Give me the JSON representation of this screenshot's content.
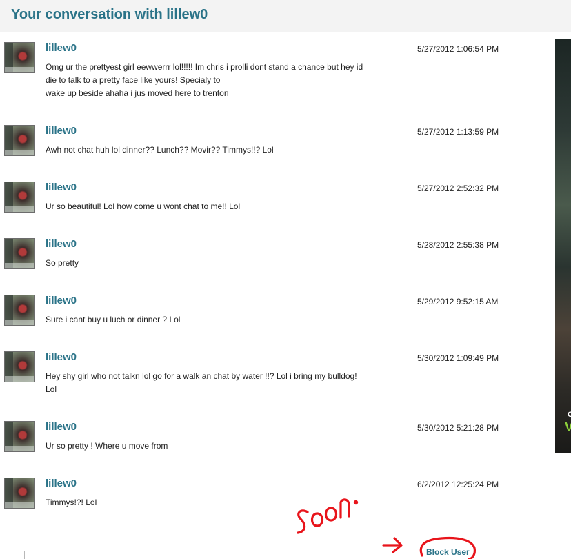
{
  "header": {
    "title": "Your conversation with lillew0"
  },
  "messages": [
    {
      "username": "lillew0",
      "timestamp": "5/27/2012 1:06:54 PM",
      "lines": [
        "Omg ur the prettyest girl eewwerrr lol!!!!! Im chris i prolli dont stand a chance but hey id",
        "die to talk to a pretty face like yours! Specialy to",
        "wake up beside ahaha i jus moved here to trenton"
      ]
    },
    {
      "username": "lillew0",
      "timestamp": "5/27/2012 1:13:59 PM",
      "lines": [
        "Awh not chat huh lol dinner?? Lunch?? Movir?? Timmys!!? Lol"
      ]
    },
    {
      "username": "lillew0",
      "timestamp": "5/27/2012 2:52:32 PM",
      "lines": [
        "Ur so beautiful! Lol how come u wont chat to me!! Lol"
      ]
    },
    {
      "username": "lillew0",
      "timestamp": "5/28/2012 2:55:38 PM",
      "lines": [
        "So pretty"
      ]
    },
    {
      "username": "lillew0",
      "timestamp": "5/29/2012 9:52:15 AM",
      "lines": [
        "Sure i cant buy u luch or dinner ? Lol"
      ]
    },
    {
      "username": "lillew0",
      "timestamp": "5/30/2012 1:09:49 PM",
      "lines": [
        "Hey shy girl who not talkn lol go for a walk an chat by water !!? Lol i bring my bulldog!",
        "Lol"
      ]
    },
    {
      "username": "lillew0",
      "timestamp": "5/30/2012 5:21:28 PM",
      "lines": [
        "Ur so pretty ! Where u move from"
      ]
    },
    {
      "username": "lillew0",
      "timestamp": "6/2/2012 12:25:24 PM",
      "lines": [
        "Timmys!?! Lol"
      ]
    }
  ],
  "actions": {
    "block_user_label": "Block User"
  },
  "annotation": {
    "handwritten_text": "soon."
  },
  "colors": {
    "accent": "#2a7388",
    "header_bg": "#f3f3f3",
    "annotation_red": "#e8141b"
  }
}
